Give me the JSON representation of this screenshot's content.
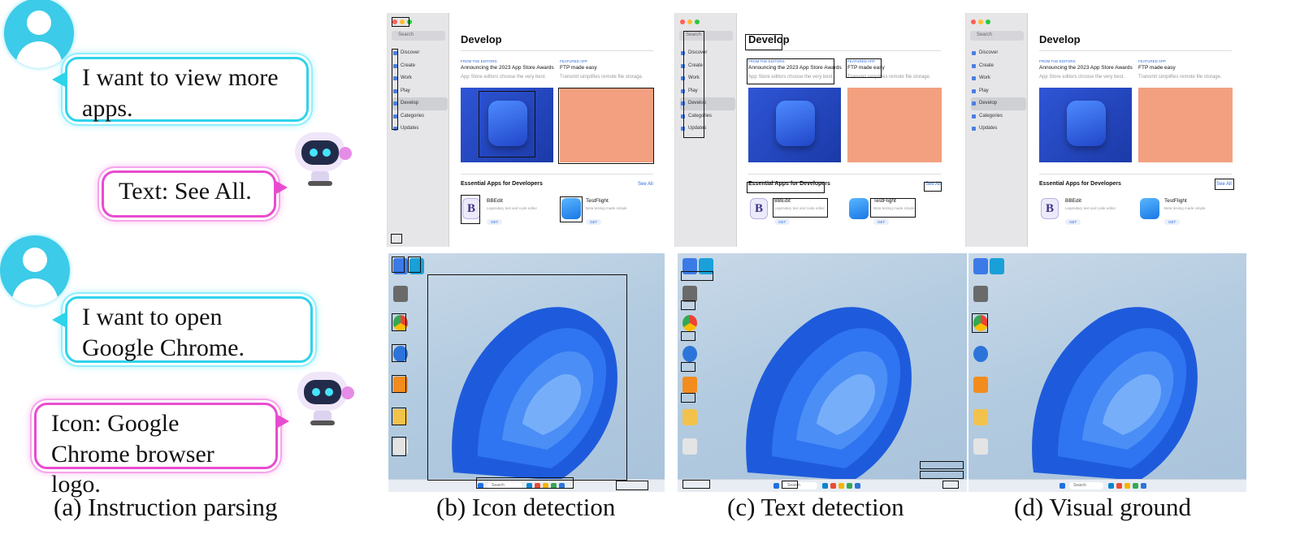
{
  "left_panel": {
    "example1": {
      "user_text": "I want to view more apps.",
      "bot_text": "Text: See All."
    },
    "example2": {
      "user_text": "I want to open Google Chrome.",
      "bot_text": "Icon: Google Chrome browser logo."
    }
  },
  "captions": {
    "a": "(a) Instruction parsing",
    "b": "(b) Icon detection",
    "c": "(c) Text detection",
    "d": "(d) Visual ground"
  },
  "app_store": {
    "sidebar": {
      "search": "Search",
      "items": [
        "Discover",
        "Create",
        "Work",
        "Play",
        "Develop",
        "Categories",
        "Updates"
      ],
      "active": "Develop"
    },
    "title": "Develop",
    "card1": {
      "label": "FROM THE EDITORS",
      "heading": "Announcing the 2023 App Store Awards",
      "sub": "App Store editors choose the very best."
    },
    "card2": {
      "label": "FEATURED APP",
      "heading": "FTP made easy",
      "sub": "Transmit simplifies remote file storage."
    },
    "section": "Essential Apps for Developers",
    "see_all": "See All",
    "apps": [
      {
        "name": "BBEdit",
        "desc": "Legendary text and code editor",
        "button": "GET"
      },
      {
        "name": "TestFlight",
        "desc": "Beta testing made simple",
        "button": "GET"
      }
    ]
  },
  "windows": {
    "taskbar_search": "Search"
  },
  "colors": {
    "cyan_bubble": "#2fd3ea",
    "pink_bubble": "#e94bd0",
    "avatar": "#3ccbe8",
    "win11_bloom": "#1e5bdc",
    "appstore_accent": "#2f6be0"
  }
}
